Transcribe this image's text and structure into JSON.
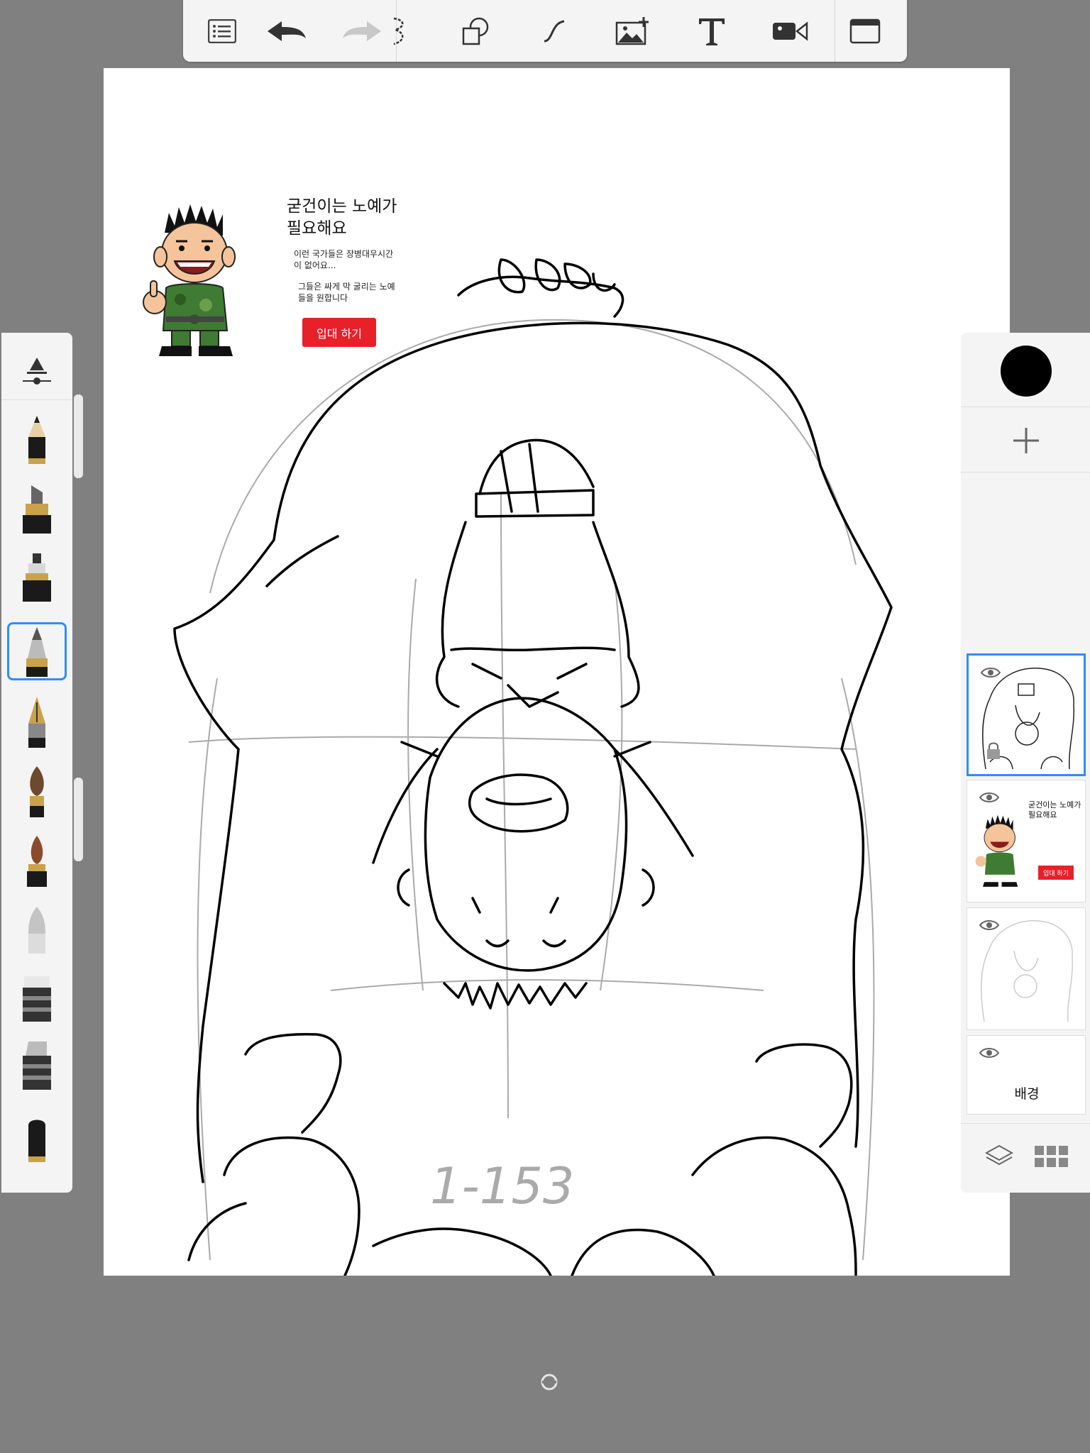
{
  "toolbar": {
    "tools": [
      "list-icon",
      "undo-icon",
      "redo-icon",
      "curve-icon",
      "shapes-icon",
      "stroke-icon",
      "image-add-icon",
      "text-icon",
      "video-icon",
      "fullscreen-icon"
    ]
  },
  "ad": {
    "title": "굳건이는 노예가 필요해요",
    "body_line1": "이런 국가들은 장병대우시간이 없어요...",
    "body_line2": "그들은 싸게 막 굴리는 노예들을 원합니다",
    "button_label": "입대 하기"
  },
  "canvas": {
    "handwritten_text": "1-153"
  },
  "brushes": [
    "pencil-icon",
    "marker-icon",
    "pen-icon",
    "fineliner-icon",
    "fountain-pen-icon",
    "brush-icon",
    "ink-brush-icon",
    "airbrush-icon",
    "eraser-icon",
    "flat-eraser-icon",
    "fill-icon"
  ],
  "color": {
    "current": "#000000",
    "accent": "#2d8cff",
    "ad_red": "#e8202a"
  },
  "layers": {
    "thumbnail_title": "굳건이는 노예가 필요해요",
    "thumbnail_button": "입대 하기",
    "background_label": "배경"
  }
}
